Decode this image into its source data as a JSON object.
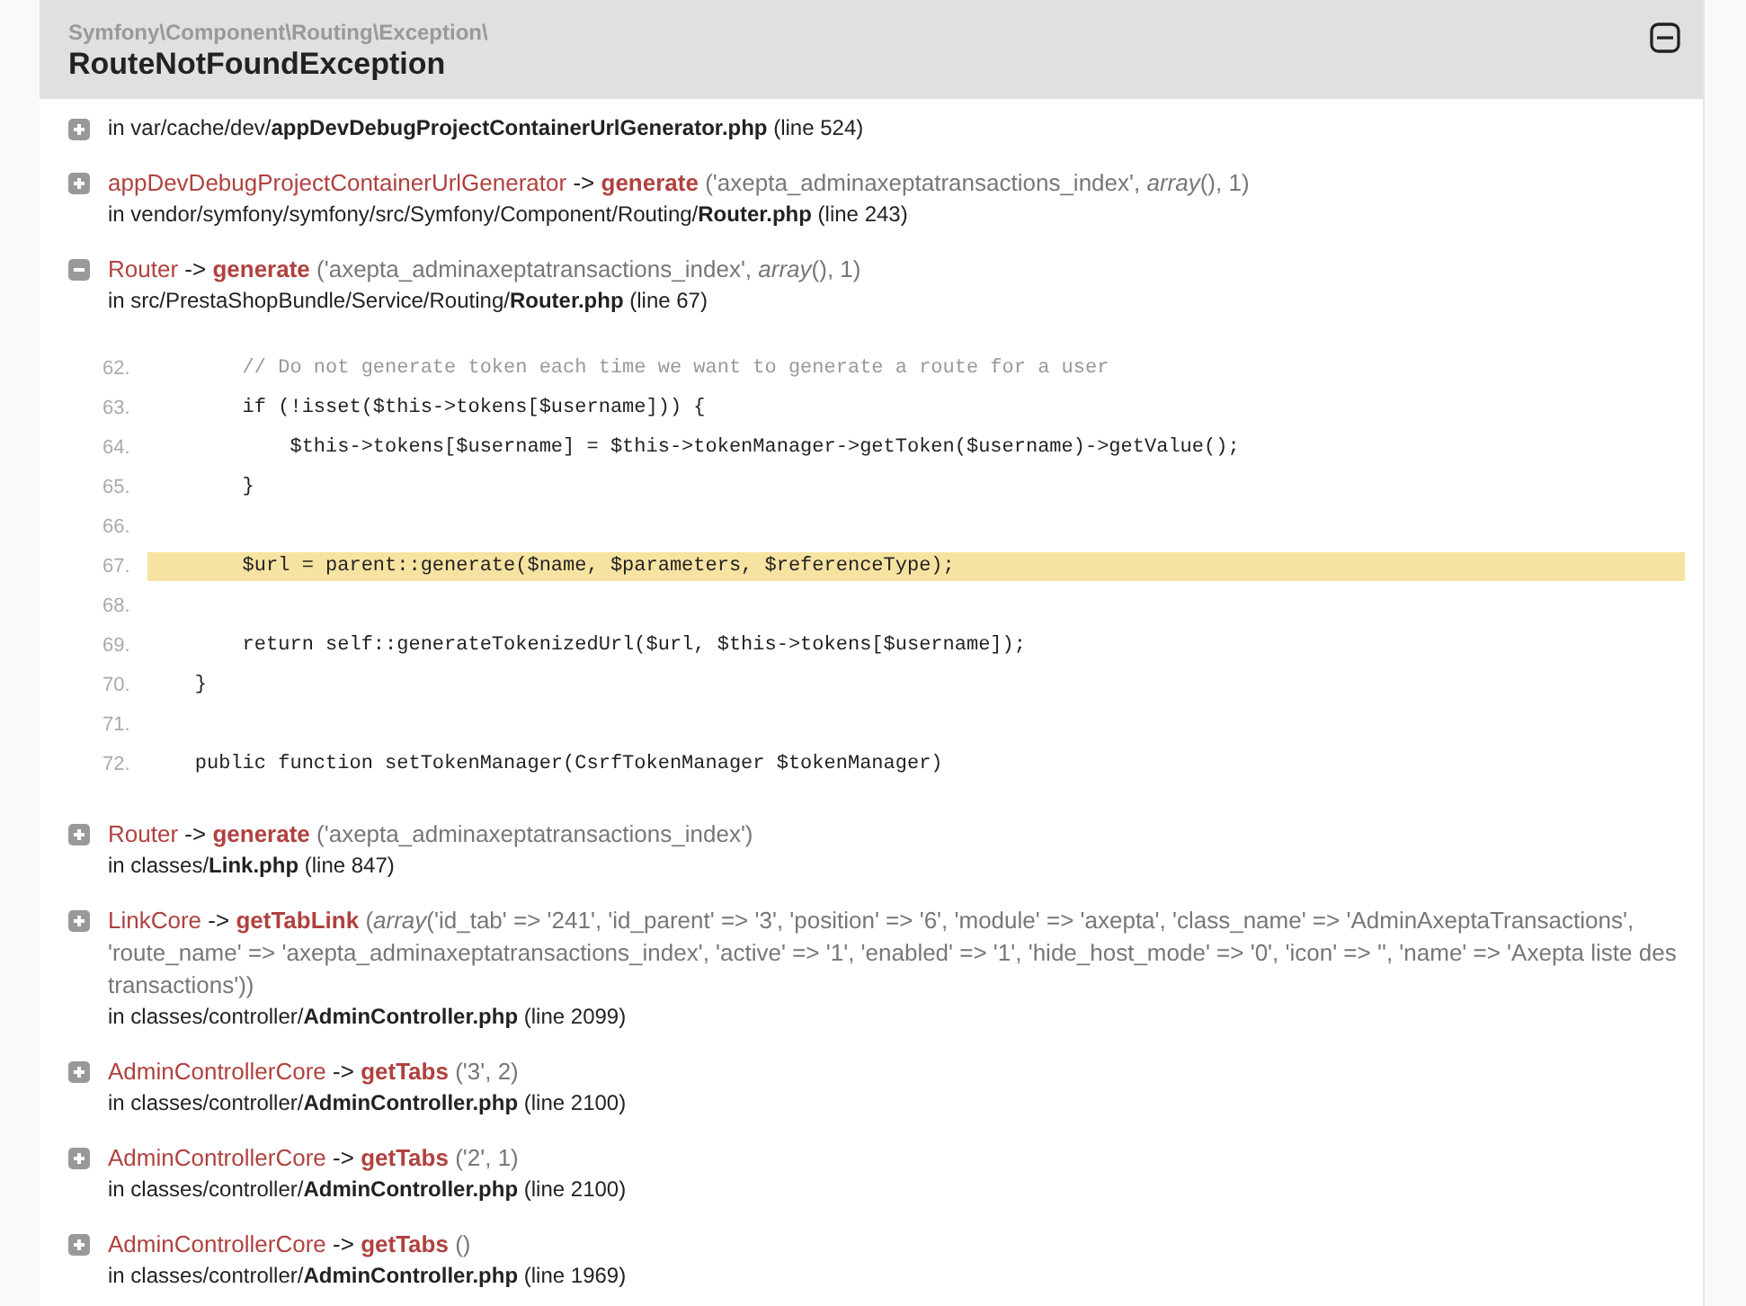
{
  "exception": {
    "namespace": "Symfony\\Component\\Routing\\Exception\\",
    "class": "RouteNotFoundException",
    "expanded": true
  },
  "trace": [
    {
      "expanded": false,
      "location": "in var/cache/dev/**appDevDebugProjectContainerUrlGenerator.php** (line 524)"
    },
    {
      "expanded": false,
      "call": {
        "class": "appDevDebugProjectContainerUrlGenerator",
        "arrow": "->",
        "method": "generate",
        "args": "('axepta_adminaxeptatransactions_index', *array*(), 1)"
      },
      "location": "in vendor/symfony/symfony/src/Symfony/Component/Routing/**Router.php** (line 243)"
    },
    {
      "expanded": true,
      "call": {
        "class": "Router",
        "arrow": "->",
        "method": "generate",
        "args": "('axepta_adminaxeptatransactions_index', *array*(), 1)"
      },
      "location": "in src/PrestaShopBundle/Service/Routing/**Router.php** (line 67)",
      "code": [
        {
          "number": "62.",
          "text": "        // Do not generate token each time we want to generate a route for a user",
          "kind": "comment",
          "selected": false
        },
        {
          "number": "63.",
          "text": "        if (!isset($this->tokens[$username])) {",
          "kind": "code",
          "selected": false
        },
        {
          "number": "64.",
          "text": "            $this->tokens[$username] = $this->tokenManager->getToken($username)->getValue();",
          "kind": "code",
          "selected": false
        },
        {
          "number": "65.",
          "text": "        }",
          "kind": "code",
          "selected": false
        },
        {
          "number": "66.",
          "kind": "code",
          "selected": false
        },
        {
          "number": "67.",
          "text": "        $url = parent::generate($name, $parameters, $referenceType);",
          "kind": "code",
          "selected": true
        },
        {
          "number": "68.",
          "kind": "code",
          "selected": false
        },
        {
          "number": "69.",
          "text": "        return self::generateTokenizedUrl($url, $this->tokens[$username]);",
          "kind": "code",
          "selected": false
        },
        {
          "number": "70.",
          "text": "    }",
          "kind": "code",
          "selected": false
        },
        {
          "number": "71.",
          "kind": "code",
          "selected": false
        },
        {
          "number": "72.",
          "text": "    public function setTokenManager(CsrfTokenManager $tokenManager)",
          "kind": "code",
          "selected": false
        }
      ]
    },
    {
      "expanded": false,
      "call": {
        "class": "Router",
        "arrow": "->",
        "method": "generate",
        "args": "('axepta_adminaxeptatransactions_index')"
      },
      "location": "in classes/**Link.php** (line 847)"
    },
    {
      "expanded": false,
      "call": {
        "class": "LinkCore",
        "arrow": "->",
        "method": "getTabLink",
        "args": "(*array*('id_tab' => '241', 'id_parent' => '3', 'position' => '6', 'module' => 'axepta', 'class_name' => 'AdminAxeptaTransactions', 'route_name' => 'axepta_adminaxeptatransactions_index', 'active' => '1', 'enabled' => '1', 'hide_host_mode' => '0', 'icon' => '', 'name' => 'Axepta liste des transactions'))"
      },
      "location": "in classes/controller/**AdminController.php** (line 2099)"
    },
    {
      "expanded": false,
      "call": {
        "class": "AdminControllerCore",
        "arrow": "->",
        "method": "getTabs",
        "args": "('3', 2)"
      },
      "location": "in classes/controller/**AdminController.php** (line 2100)"
    },
    {
      "expanded": false,
      "call": {
        "class": "AdminControllerCore",
        "arrow": "->",
        "method": "getTabs",
        "args": "('2', 1)"
      },
      "location": "in classes/controller/**AdminController.php** (line 2100)"
    },
    {
      "expanded": false,
      "call": {
        "class": "AdminControllerCore",
        "arrow": "->",
        "method": "getTabs",
        "args": "()"
      },
      "location": "in classes/controller/**AdminController.php** (line 1969)"
    }
  ]
}
